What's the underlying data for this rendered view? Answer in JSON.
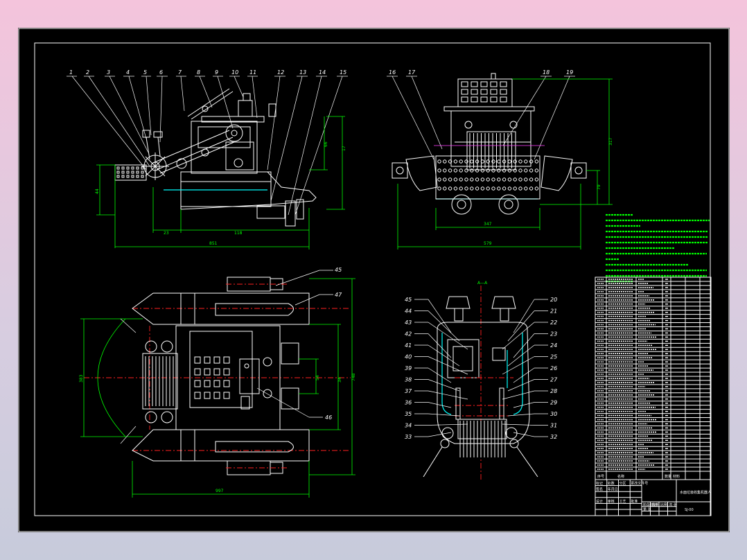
{
  "drawing": {
    "background": "#000000",
    "line_color": "#ffffff",
    "dimension_color": "#00ff00",
    "centerline_color": "#ff2020",
    "highlight_color": "#00ffff"
  },
  "side_view": {
    "balloons": [
      "1",
      "2",
      "3",
      "4",
      "5",
      "6",
      "7",
      "8",
      "9",
      "10",
      "11",
      "12",
      "13",
      "14",
      "15"
    ],
    "dimensions": {
      "overall_width": "851",
      "left_span": "23",
      "mid_span": "118",
      "height_a": "17",
      "height_b": "66",
      "height_c": "44"
    }
  },
  "front_view": {
    "balloons": [
      "16",
      "17",
      "18",
      "19"
    ],
    "dimensions": {
      "overall_width": "579",
      "inner_width": "347",
      "overall_height": "317",
      "lower_height": "79"
    }
  },
  "top_view": {
    "balloons": [
      "45",
      "46",
      "47"
    ],
    "dimensions": {
      "overall_length": "997",
      "overall_width": "748",
      "inner_width": "54",
      "arc_radius": "383",
      "side_span": "34"
    }
  },
  "section_view": {
    "left_balloons": [
      "45",
      "44",
      "43",
      "42",
      "41",
      "40",
      "39",
      "38",
      "37",
      "36",
      "35",
      "34",
      "33"
    ],
    "right_balloons": [
      "20",
      "21",
      "22",
      "23",
      "24",
      "25",
      "26",
      "27",
      "28",
      "29",
      "30",
      "31",
      "32"
    ],
    "section_mark": "A—A"
  },
  "parts_list": {
    "row_count": 47,
    "header": [
      "序号",
      "名称",
      "数量",
      "材料"
    ]
  },
  "title_block": {
    "name": "水面垃圾收集机器人",
    "drawing_no": "SJ-00",
    "fields": [
      "标记",
      "处数",
      "分区",
      "更改文件号",
      "签名",
      "年月日",
      "设计",
      "审核",
      "工艺",
      "批准",
      "阶段标记",
      "重量",
      "比例",
      "共 张",
      "第 张"
    ]
  }
}
